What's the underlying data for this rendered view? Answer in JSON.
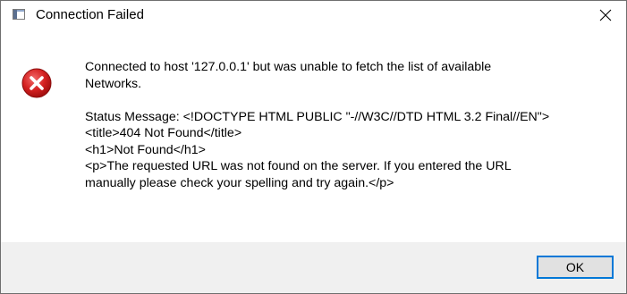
{
  "window": {
    "title": "Connection Failed",
    "close_icon": "close-icon",
    "app_icon": "window-icon"
  },
  "message": {
    "icon": "error-icon",
    "line1": "Connected to host '127.0.0.1' but was unable to fetch the list of available",
    "line2": "Networks.",
    "status_line1": "Status Message: <!DOCTYPE HTML PUBLIC \"-//W3C//DTD HTML 3.2 Final//EN\">",
    "status_line2": "<title>404 Not Found</title>",
    "status_line3": "<h1>Not Found</h1>",
    "status_line4": "<p>The requested URL was not found on the server. If you entered the URL",
    "status_line5": "manually please check your spelling and try again.</p>"
  },
  "buttons": {
    "ok_label": "OK"
  },
  "colors": {
    "error_red": "#e81123",
    "accent": "#0078d7",
    "footer_bg": "#f0f0f0"
  }
}
